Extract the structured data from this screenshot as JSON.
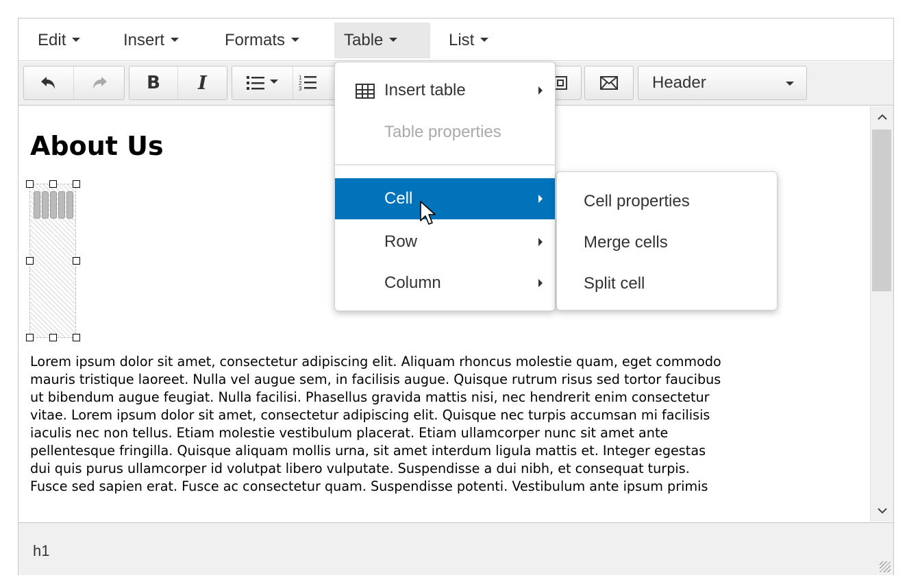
{
  "menubar": {
    "items": [
      {
        "label": "Edit"
      },
      {
        "label": "Insert"
      },
      {
        "label": "Formats"
      },
      {
        "label": "Table"
      },
      {
        "label": "List"
      }
    ],
    "active": "Table"
  },
  "toolbar": {
    "undo_icon": "undo-icon",
    "redo_icon": "redo-icon",
    "bold_label": "B",
    "italic_label": "I",
    "block_select": {
      "value": "Header"
    }
  },
  "content": {
    "heading": "About Us",
    "paragraph": "Lorem ipsum dolor sit amet, consectetur adipiscing elit. Aliquam rhoncus molestie quam, eget commodo\nmauris tristique laoreet. Nulla vel augue sem, in facilisis augue. Quisque rutrum risus sed tortor faucibus\nut bibendum augue feugiat. Nulla facilisi. Phasellus gravida mattis nisi, nec hendrerit enim consectetur\nvitae. Lorem ipsum dolor sit amet, consectetur adipiscing elit. Quisque nec turpis accumsan mi facilisis\niaculis nec non tellus. Etiam molestie vestibulum placerat. Etiam ullamcorper nunc sit amet ante\npellentesque fringilla. Quisque aliquam mollis urna, sit amet interdum ligula mattis et. Integer egestas\ndui quis purus ullamcorper id volutpat libero vulputate. Suspendisse a dui nibh, et consequat turpis.\nFusce sed sapien erat. Fusce ac consectetur quam. Suspendisse potenti. Vestibulum ante ipsum primis"
  },
  "table_menu": {
    "insert_table": "Insert table",
    "table_properties": "Table properties",
    "cell": "Cell",
    "row": "Row",
    "column": "Column"
  },
  "cell_submenu": {
    "cell_properties": "Cell properties",
    "merge_cells": "Merge cells",
    "split_cell": "Split cell"
  },
  "statusbar": {
    "path": "h1"
  },
  "colors": {
    "highlight": "#0073bb",
    "toolbar_bg": "#f0f0f0",
    "border": "#c5c5c5"
  }
}
